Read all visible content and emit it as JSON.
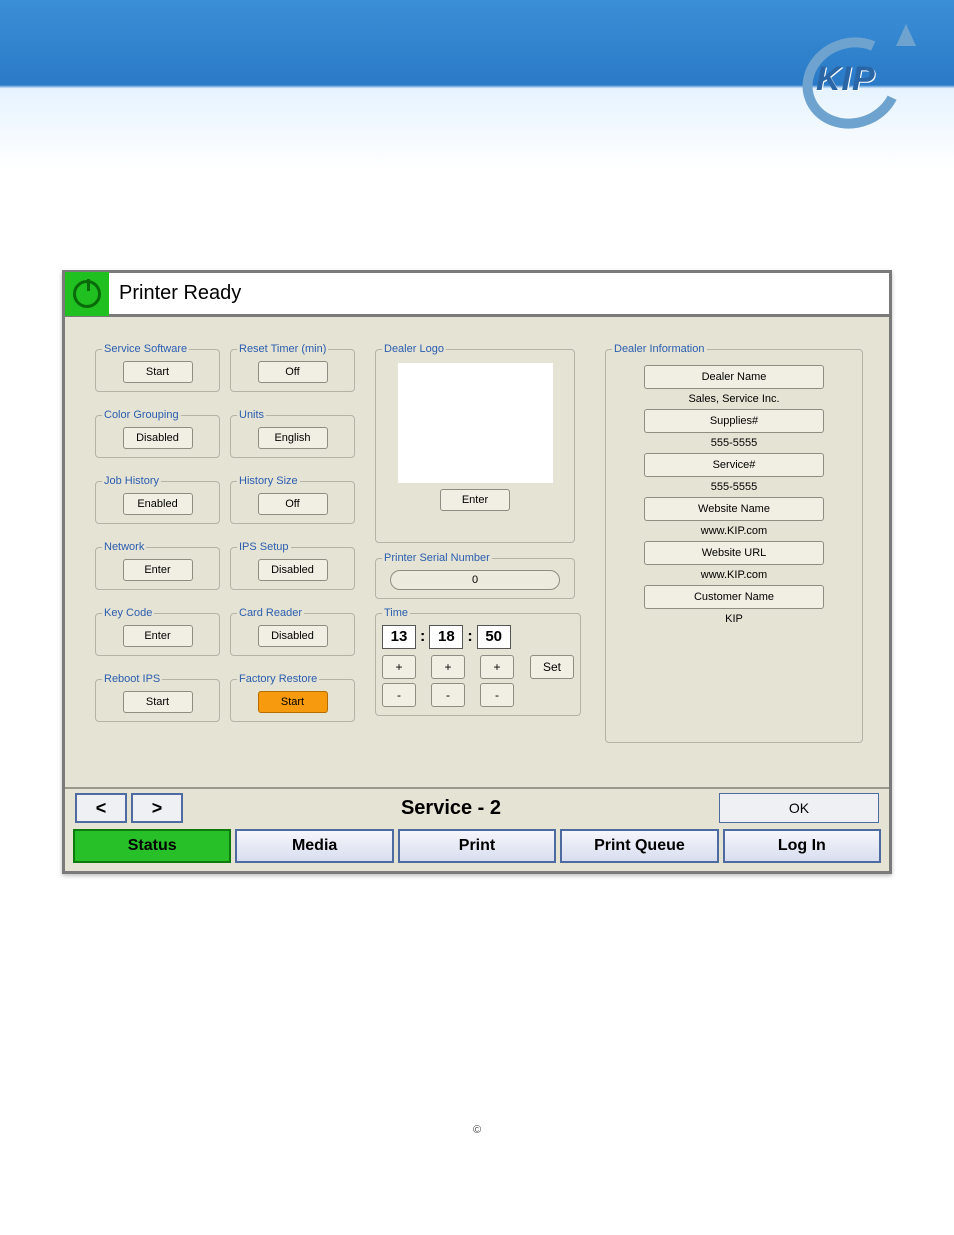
{
  "banner_logo_text": "KIP",
  "titlebar": {
    "title": "Printer Ready"
  },
  "left": {
    "service_software": {
      "legend": "Service Software",
      "btn": "Start"
    },
    "reset_timer": {
      "legend": "Reset Timer (min)",
      "btn": "Off"
    },
    "color_grouping": {
      "legend": "Color Grouping",
      "btn": "Disabled"
    },
    "units": {
      "legend": "Units",
      "btn": "English"
    },
    "job_history": {
      "legend": "Job History",
      "btn": "Enabled"
    },
    "history_size": {
      "legend": "History Size",
      "btn": "Off"
    },
    "network": {
      "legend": "Network",
      "btn": "Enter"
    },
    "ips_setup": {
      "legend": "IPS Setup",
      "btn": "Disabled"
    },
    "key_code": {
      "legend": "Key Code",
      "btn": "Enter"
    },
    "card_reader": {
      "legend": "Card Reader",
      "btn": "Disabled"
    },
    "reboot_ips": {
      "legend": "Reboot IPS",
      "btn": "Start"
    },
    "factory_restore": {
      "legend": "Factory Restore",
      "btn": "Start"
    }
  },
  "dealer_logo": {
    "legend": "Dealer Logo",
    "enter": "Enter"
  },
  "serial": {
    "legend": "Printer Serial Number",
    "value": "0"
  },
  "time": {
    "legend": "Time",
    "h": "13",
    "m": "18",
    "s": "50",
    "plus": "+",
    "minus": "-",
    "set": "Set"
  },
  "dealer_info": {
    "legend": "Dealer Information",
    "dealer_name_btn": "Dealer Name",
    "dealer_name_val": "Sales, Service Inc.",
    "supplies_btn": "Supplies#",
    "supplies_val": "555-5555",
    "service_btn": "Service#",
    "service_val": "555-5555",
    "web_name_btn": "Website Name",
    "web_name_val": "www.KIP.com",
    "web_url_btn": "Website URL",
    "web_url_val": "www.KIP.com",
    "customer_btn": "Customer Name",
    "customer_val": "KIP"
  },
  "footer": {
    "prev": "<",
    "next": ">",
    "page": "Service - 2",
    "ok": "OK",
    "tabs": {
      "status": "Status",
      "media": "Media",
      "print": "Print",
      "queue": "Print Queue",
      "login": "Log In"
    }
  },
  "copyright": "©"
}
